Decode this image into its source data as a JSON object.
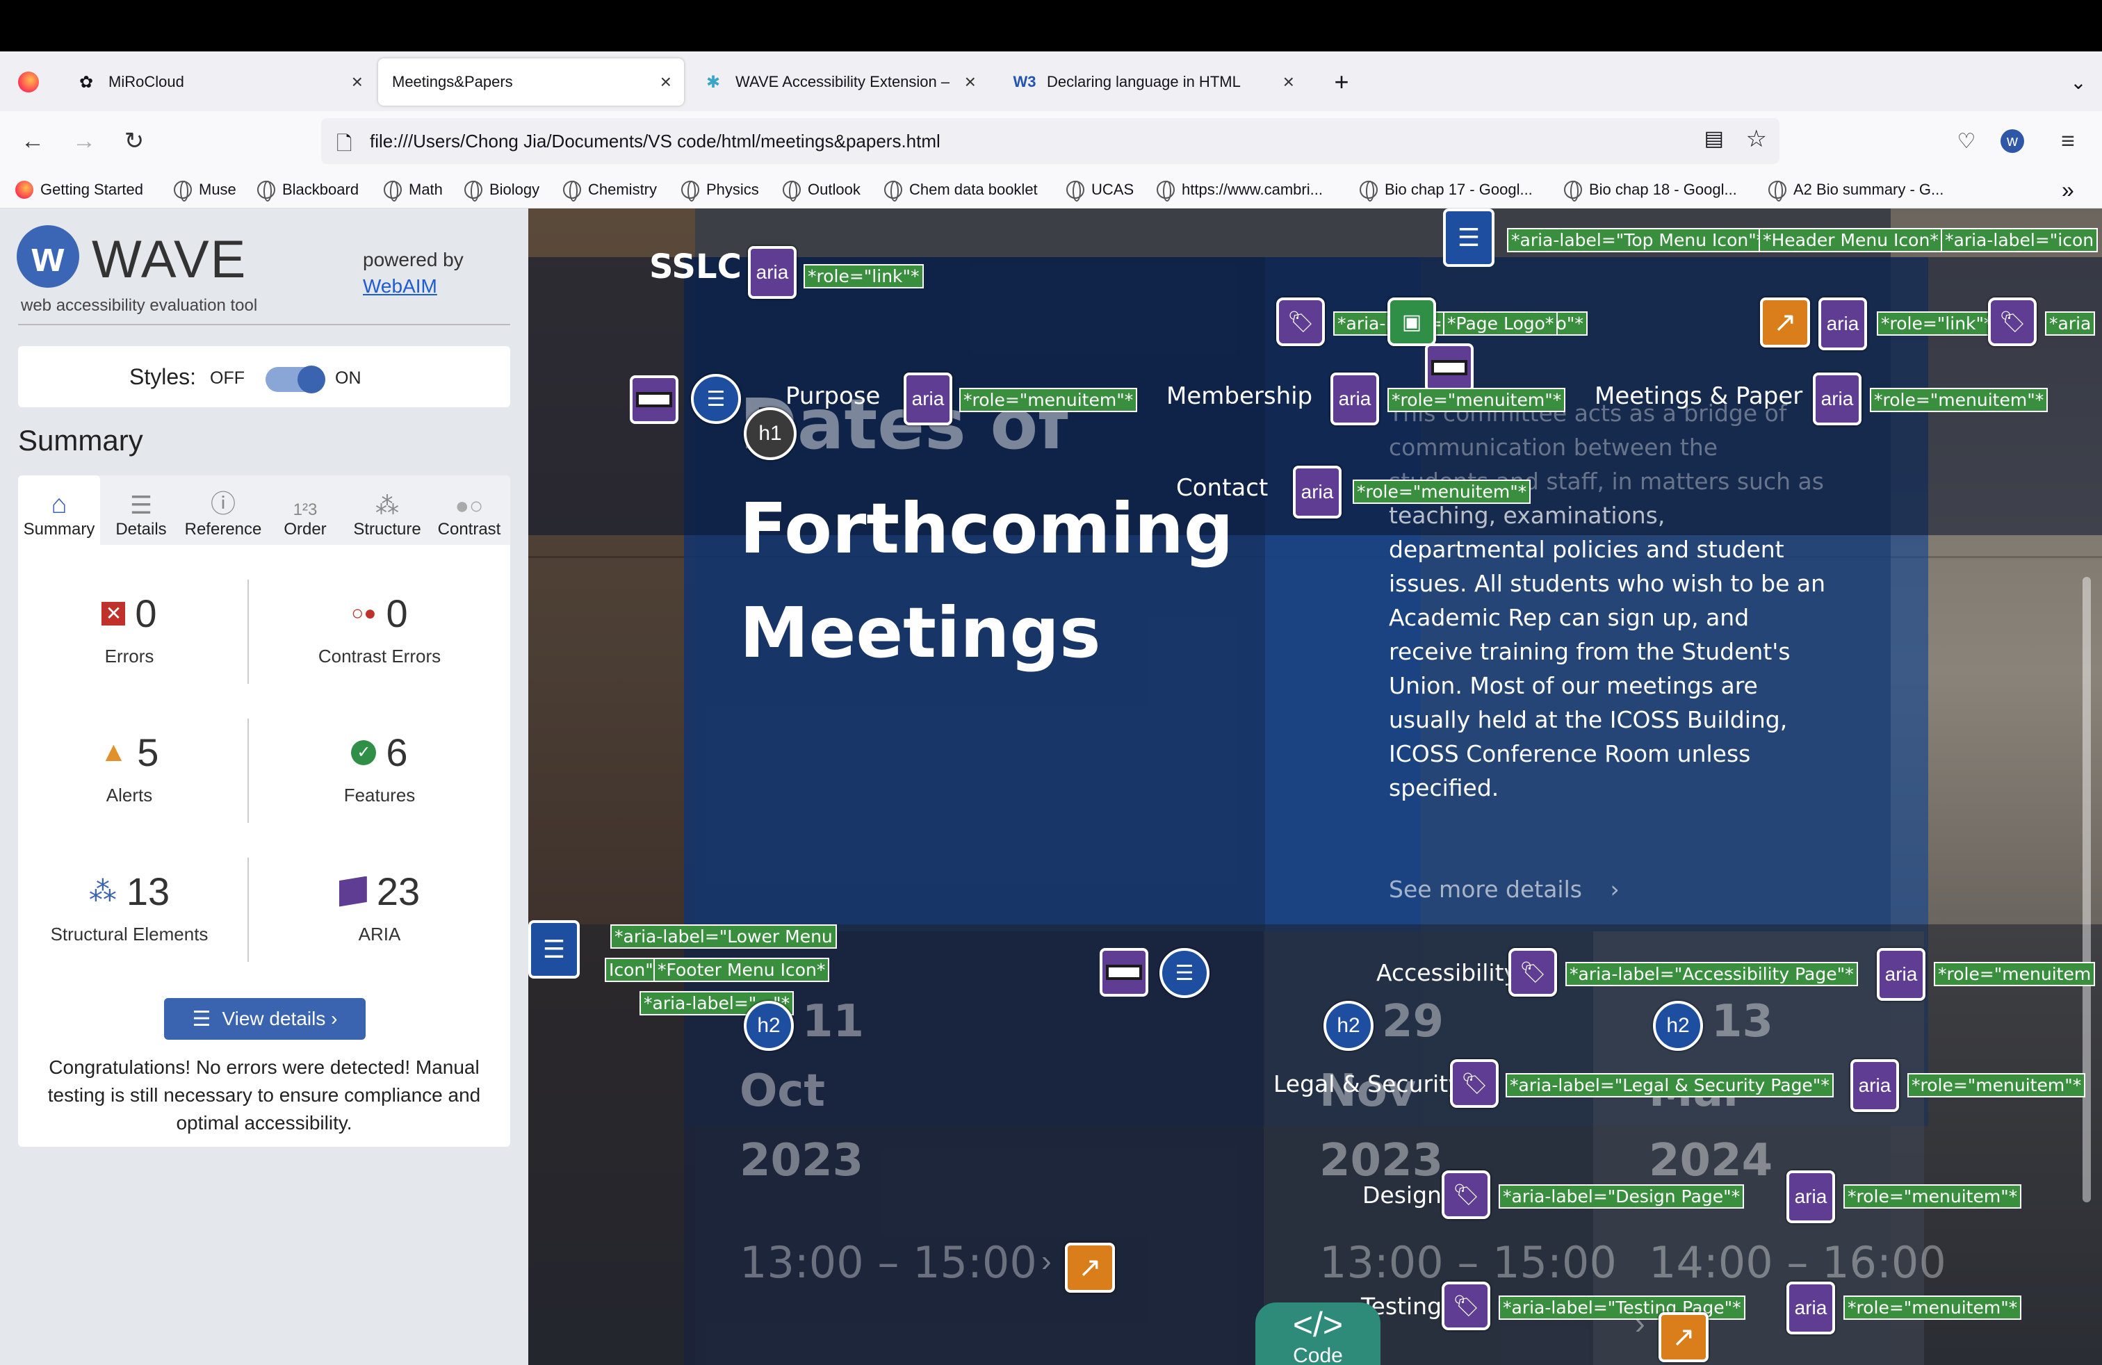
{
  "browser": {
    "tabs": [
      {
        "title": "MiRoCloud"
      },
      {
        "title": "Meetings&Papers"
      },
      {
        "title": "WAVE Accessibility Extension –"
      },
      {
        "title": "Declaring language in HTML"
      }
    ],
    "url": "file:///Users/Chong Jia/Documents/VS code/html/meetings&papers.html",
    "bookmarks": [
      "Getting Started",
      "Muse",
      "Blackboard",
      "Math",
      "Biology",
      "Chemistry",
      "Physics",
      "Outlook",
      "Chem data booklet",
      "UCAS",
      "https://www.cambri...",
      "Bio chap 17 - Googl...",
      "Bio chap 18 - Googl...",
      "A2 Bio summary - G..."
    ]
  },
  "wave": {
    "brand": "WAVE",
    "tagline": "web accessibility evaluation tool",
    "powered_by": "powered by",
    "webaim": "WebAIM",
    "styles_label": "Styles:",
    "off": "OFF",
    "on": "ON",
    "summary_heading": "Summary",
    "tabs": [
      "Summary",
      "Details",
      "Reference",
      "Order",
      "Structure",
      "Contrast"
    ],
    "stats": [
      {
        "num": "0",
        "label": "Errors"
      },
      {
        "num": "0",
        "label": "Contrast Errors"
      },
      {
        "num": "5",
        "label": "Alerts"
      },
      {
        "num": "6",
        "label": "Features"
      },
      {
        "num": "13",
        "label": "Structural Elements"
      },
      {
        "num": "23",
        "label": "ARIA"
      }
    ],
    "view_details": "View details ›",
    "congrats": "Congratulations! No errors were detected! Manual testing is still necessary to ensure compliance and optimal accessibility."
  },
  "page": {
    "logo": "SSLC",
    "menu": [
      "Purpose",
      "Membership",
      "Meetings & Paper",
      "Contact"
    ],
    "heading": [
      "Dates of",
      "Forthcoming",
      "Meetings"
    ],
    "description": [
      "This committee acts as a bridge of",
      "communication between the",
      "students and staff, in matters such as",
      "teaching, examinations,",
      "departmental policies and student",
      "issues. All students who wish to be an",
      "Academic Rep can sign up, and",
      "receive training from the Student's",
      "Union. Most of our meetings are",
      "usually held at the ICOSS Building,",
      "ICOSS Conference Room unless",
      "specified."
    ],
    "see_more": "See more details",
    "meetings": [
      {
        "day": "11",
        "month": "Oct",
        "year": "2023",
        "time": "13:00 – 15:00"
      },
      {
        "day": "29",
        "month": "Nov",
        "year": "2023",
        "time": "13:00 – 15:00"
      },
      {
        "day": "13",
        "month": "Mar",
        "year": "2024",
        "time": "14:00 – 16:00"
      }
    ],
    "footer_menu": [
      "Accessibility",
      "Legal & Security",
      "Design",
      "Testing"
    ],
    "code_label": "Code"
  },
  "overlays": {
    "aria": "aria",
    "h1": "h1",
    "h2": "h2",
    "role_link": "*role=\"link\"*",
    "role_menuitem": "*role=\"menuitem\"*",
    "role_menuitem_cut": "*role=\"menuitem",
    "top_menu": "*aria-label=\"Top Menu Icon\"*",
    "header_menu": "*Header Menu Icon*",
    "icon_cut": "*aria-label=\"icon",
    "website_logo": "*aria-label=\"Website Logo\"*",
    "page_logo": "*Page Logo*",
    "aria_cut": "*aria",
    "lower_menu_1": "*aria-label=\"Lower Menu",
    "lower_menu_2": "Icon\"*",
    "footer_menu_icon": "*Footer Menu Icon*",
    "lower_menu_3": "*aria-label=\"...\"*",
    "accessibility_page": "*aria-label=\"Accessibility Page\"*",
    "legal_page": "*aria-label=\"Legal & Security Page\"*",
    "design_page": "*aria-label=\"Design Page\"*",
    "testing_page": "*aria-label=\"Testing Page\"*"
  }
}
